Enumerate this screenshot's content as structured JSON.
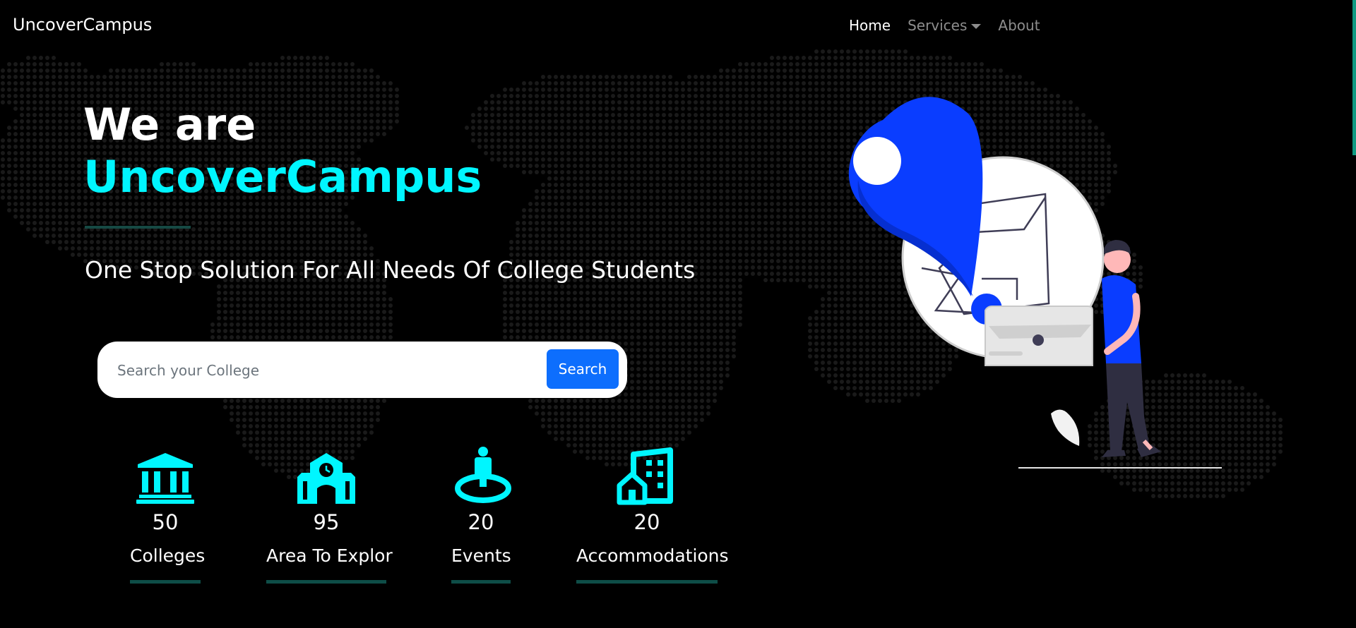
{
  "navbar": {
    "brand": "UncoverCampus",
    "links": [
      {
        "label": "Home",
        "active": true
      },
      {
        "label": "Services",
        "dropdown": true
      },
      {
        "label": "About"
      }
    ]
  },
  "hero": {
    "title_line1": "We are",
    "title_line2": "UncoverCampus",
    "tagline": "One Stop Solution For All Needs Of College Students"
  },
  "search": {
    "placeholder": "Search your College",
    "value": "",
    "button_label": "Search"
  },
  "stats": [
    {
      "icon": "university-icon",
      "value": "50",
      "label": "Colleges"
    },
    {
      "icon": "school-icon",
      "value": "95",
      "label": "Area To Explor"
    },
    {
      "icon": "person-pin-icon",
      "value": "20",
      "label": "Events"
    },
    {
      "icon": "building-icon",
      "value": "20",
      "label": "Accommodations"
    }
  ],
  "colors": {
    "background": "#000000",
    "accent_cyan": "#00f6ff",
    "primary_blue": "#0d6efd",
    "illustration_blue": "#0a3dff",
    "underline_teal": "#0e4d47"
  }
}
